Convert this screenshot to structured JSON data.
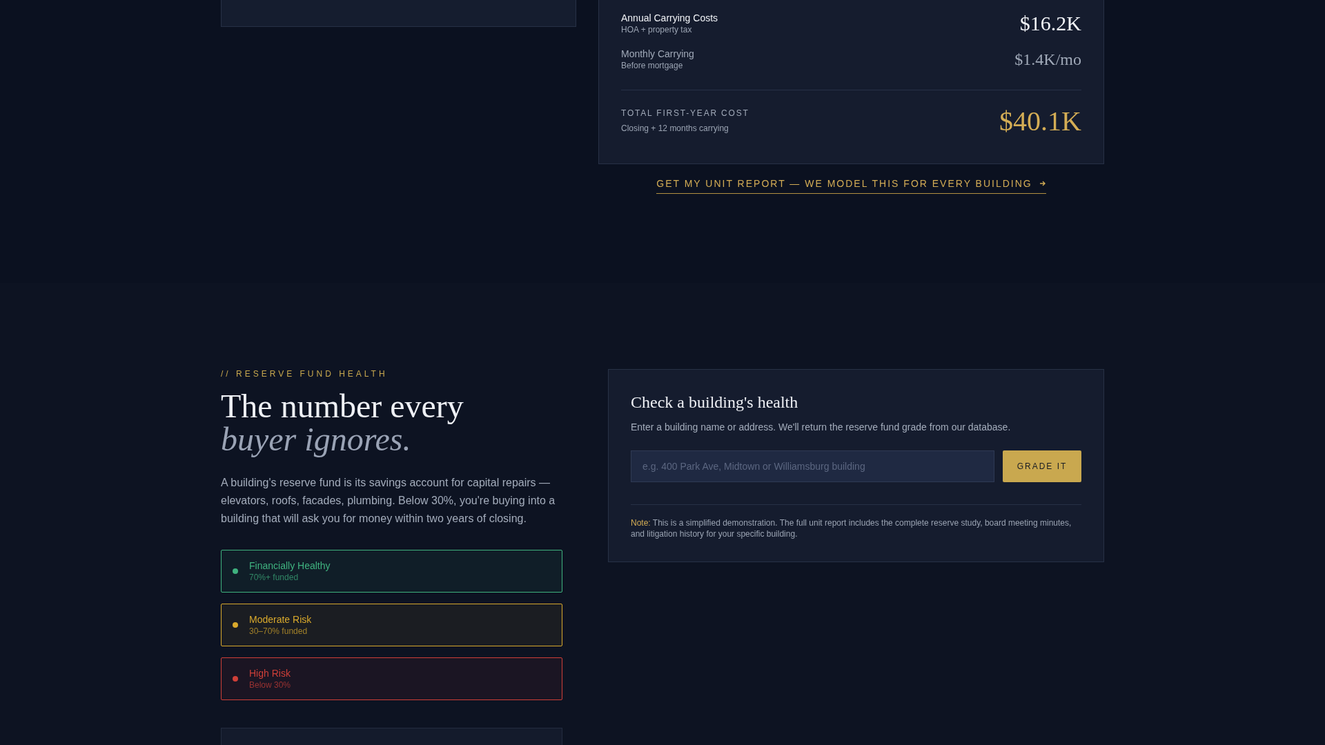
{
  "cost_summary": {
    "rows": [
      {
        "kind": "primary",
        "label": "Annual Carrying Costs",
        "sublabel": "HOA + property tax",
        "value": "$16.2K"
      },
      {
        "kind": "secondary",
        "label": "Monthly Carrying",
        "sublabel": "Before mortgage",
        "value": "$1.4K/mo"
      }
    ],
    "total": {
      "label": "TOTAL FIRST-YEAR COST",
      "sublabel": "Closing + 12 months carrying",
      "value": "$40.1K"
    },
    "cta_link": "GET MY UNIT REPORT — WE MODEL THIS FOR EVERY BUILDING"
  },
  "reserve_section": {
    "eyebrow": "// RESERVE FUND HEALTH",
    "headline_line_1": "The number every",
    "headline_line_2": "buyer ignores.",
    "body": "A building's reserve fund is its savings account for capital repairs — elevators, roofs, facades, plumbing. Below 30%, you're buying into a building that will ask you for money within two years of closing.",
    "risk_levels": [
      {
        "title": "Financially Healthy",
        "range": "70%+ funded",
        "color": "#3fb27f"
      },
      {
        "title": "Moderate Risk",
        "range": "30–70% funded",
        "color": "#d9a92c"
      },
      {
        "title": "High Risk",
        "range": "Below 30%",
        "color": "#cf3f38"
      }
    ]
  },
  "health_check": {
    "title": "Check a building's health",
    "description": "Enter a building name or address. We'll return the reserve fund grade from our database.",
    "search": {
      "placeholder": "e.g. 400 Park Ave, Midtown or Williamsburg building"
    },
    "button": "GRADE IT",
    "note_label": "Note:",
    "note_text": "This is a simplified demonstration. The full unit report includes the complete reserve study, board meeting minutes, and litigation history for your specific building."
  }
}
